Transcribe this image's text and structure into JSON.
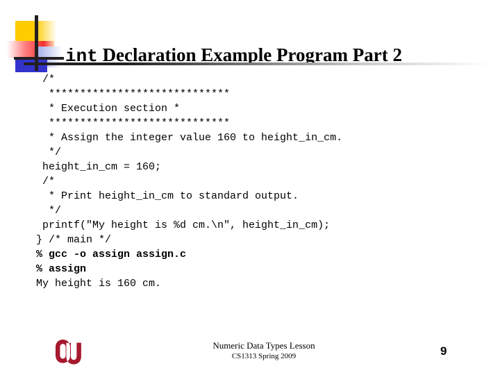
{
  "slide": {
    "title_mono": "int",
    "title_rest": " Declaration Example Program Part 2"
  },
  "code": {
    "lines": [
      {
        "text": " /*",
        "bold": false
      },
      {
        "text": "  *****************************",
        "bold": false
      },
      {
        "text": "  * Execution section *",
        "bold": false
      },
      {
        "text": "  *****************************",
        "bold": false
      },
      {
        "text": "  * Assign the integer value 160 to height_in_cm.",
        "bold": false
      },
      {
        "text": "  */",
        "bold": false
      },
      {
        "text": " height_in_cm = 160;",
        "bold": false
      },
      {
        "text": " /*",
        "bold": false
      },
      {
        "text": "  * Print height_in_cm to standard output.",
        "bold": false
      },
      {
        "text": "  */",
        "bold": false
      },
      {
        "text": " printf(\"My height is %d cm.\\n\", height_in_cm);",
        "bold": false
      },
      {
        "text": "} /* main */",
        "bold": false
      },
      {
        "text": "% gcc -o assign assign.c",
        "bold": true
      },
      {
        "text": "% assign",
        "bold": true
      },
      {
        "text": "My height is 160 cm.",
        "bold": false
      }
    ]
  },
  "footer": {
    "lesson": "Numeric Data Types Lesson",
    "course": "CS1313 Spring 2009",
    "page_number": "9",
    "logo_alt": "OU"
  },
  "colors": {
    "yellow": "#ffcc00",
    "red": "#f23030",
    "blue": "#3333cc",
    "bar": "#231f20",
    "crimson": "#a6192e",
    "text": "#000000"
  }
}
